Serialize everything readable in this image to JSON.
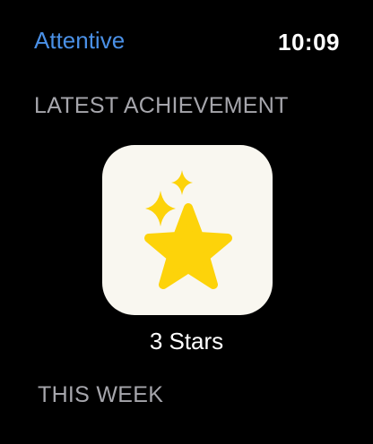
{
  "header": {
    "app_title": "Attentive",
    "time": "10:09"
  },
  "sections": {
    "latest_heading": "LATEST ACHIEVEMENT",
    "week_heading": "THIS WEEK"
  },
  "achievement": {
    "name": "3 Stars",
    "icon": "stars-icon",
    "tile_color": "#f9f7f0",
    "star_color": "#fdd30a"
  },
  "colors": {
    "accent": "#4a90e6",
    "background": "#000000",
    "section_heading": "#a6a6ac"
  }
}
